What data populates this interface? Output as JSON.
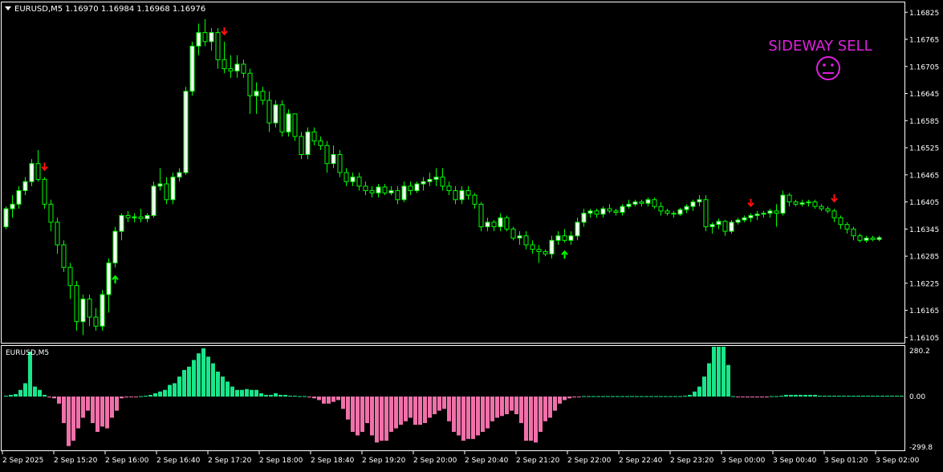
{
  "header": {
    "symbol_line": "EURUSD,M5  1.16970 1.16984 1.16968 1.16976",
    "dropdown_icon": "triangle-down-icon"
  },
  "signal": {
    "text": "SIDEWAY SELL",
    "icon": "neutral-face-icon",
    "color": "#e020e0"
  },
  "colors": {
    "background": "#000000",
    "frame": "#ffffff",
    "bull_body": "#ffffff",
    "bear_body": "#000000",
    "wick": "#00ff00",
    "sell_arrow": "#ff1010",
    "buy_arrow": "#00ff00",
    "histogram_positive": "#19e68a",
    "histogram_negative": "#f071aa",
    "zero_line": "#19e68a"
  },
  "indicator": {
    "label": "EURUSD,M5",
    "axis_labels": [
      "280.2",
      "0.00",
      "-299.8"
    ]
  },
  "chart_data": {
    "type": "candlestick",
    "title": "EURUSD,M5",
    "price_axis": {
      "ticks": [
        "1.16825",
        "1.16765",
        "1.16705",
        "1.16645",
        "1.16585",
        "1.16525",
        "1.16465",
        "1.16405",
        "1.16345",
        "1.16285",
        "1.16225",
        "1.16165",
        "1.16105"
      ],
      "ylim": [
        1.16095,
        1.16845
      ]
    },
    "time_axis": {
      "ticks": [
        "2 Sep 2025",
        "2 Sep 15:20",
        "2 Sep 16:00",
        "2 Sep 16:40",
        "2 Sep 17:20",
        "2 Sep 18:00",
        "2 Sep 18:40",
        "2 Sep 19:20",
        "2 Sep 20:00",
        "2 Sep 20:40",
        "2 Sep 21:20",
        "2 Sep 22:00",
        "2 Sep 22:40",
        "2 Sep 23:20",
        "3 Sep 00:00",
        "3 Sep 00:40",
        "3 Sep 01:20",
        "3 Sep 02:00"
      ],
      "bars_between_ticks": 8
    },
    "candles": [
      [
        1.1635,
        1.16395,
        1.16345,
        1.1639
      ],
      [
        1.1639,
        1.1642,
        1.1637,
        1.164
      ],
      [
        1.164,
        1.1644,
        1.1639,
        1.1643
      ],
      [
        1.1643,
        1.1646,
        1.1642,
        1.1645
      ],
      [
        1.1645,
        1.165,
        1.1644,
        1.1649
      ],
      [
        1.1649,
        1.1652,
        1.1645,
        1.16455
      ],
      [
        1.16455,
        1.1646,
        1.1639,
        1.164
      ],
      [
        1.164,
        1.1641,
        1.1634,
        1.1636
      ],
      [
        1.1636,
        1.1637,
        1.1629,
        1.1631
      ],
      [
        1.1631,
        1.1632,
        1.1625,
        1.1626
      ],
      [
        1.1626,
        1.1627,
        1.1619,
        1.1622
      ],
      [
        1.1622,
        1.1623,
        1.1612,
        1.1614
      ],
      [
        1.1614,
        1.162,
        1.1611,
        1.1619
      ],
      [
        1.1619,
        1.162,
        1.1613,
        1.1615
      ],
      [
        1.1615,
        1.1617,
        1.1612,
        1.1613
      ],
      [
        1.1613,
        1.1621,
        1.1612,
        1.162
      ],
      [
        1.162,
        1.1628,
        1.1616,
        1.1627
      ],
      [
        1.1627,
        1.1635,
        1.1626,
        1.1634
      ],
      [
        1.1634,
        1.1638,
        1.1632,
        1.16375
      ],
      [
        1.16375,
        1.16385,
        1.1636,
        1.1637
      ],
      [
        1.1637,
        1.1638,
        1.1636,
        1.16372
      ],
      [
        1.16372,
        1.1639,
        1.1636,
        1.16368
      ],
      [
        1.16368,
        1.1638,
        1.1636,
        1.16375
      ],
      [
        1.16375,
        1.1645,
        1.1637,
        1.1644
      ],
      [
        1.1644,
        1.1648,
        1.1643,
        1.16445
      ],
      [
        1.16445,
        1.1646,
        1.164,
        1.1641
      ],
      [
        1.1641,
        1.1647,
        1.164,
        1.1646
      ],
      [
        1.1646,
        1.1648,
        1.1645,
        1.1647
      ],
      [
        1.1647,
        1.1666,
        1.16465,
        1.1665
      ],
      [
        1.1665,
        1.1676,
        1.1664,
        1.1675
      ],
      [
        1.1675,
        1.168,
        1.1673,
        1.1678
      ],
      [
        1.1678,
        1.1681,
        1.1675,
        1.1676
      ],
      [
        1.1676,
        1.1679,
        1.1674,
        1.1678
      ],
      [
        1.1678,
        1.1679,
        1.167,
        1.1672
      ],
      [
        1.1672,
        1.1676,
        1.1669,
        1.167
      ],
      [
        1.167,
        1.1673,
        1.1668,
        1.16695
      ],
      [
        1.16695,
        1.1673,
        1.1668,
        1.1671
      ],
      [
        1.1671,
        1.1672,
        1.1668,
        1.1669
      ],
      [
        1.1669,
        1.167,
        1.166,
        1.1664
      ],
      [
        1.1664,
        1.1667,
        1.166,
        1.1665
      ],
      [
        1.1665,
        1.1666,
        1.1662,
        1.1663
      ],
      [
        1.1663,
        1.1665,
        1.1656,
        1.1658
      ],
      [
        1.1658,
        1.1663,
        1.1657,
        1.1662
      ],
      [
        1.1662,
        1.1663,
        1.1655,
        1.1656
      ],
      [
        1.1656,
        1.1661,
        1.1655,
        1.166
      ],
      [
        1.166,
        1.166,
        1.1654,
        1.1655
      ],
      [
        1.1655,
        1.1656,
        1.165,
        1.1651
      ],
      [
        1.1651,
        1.1657,
        1.165,
        1.1656
      ],
      [
        1.1656,
        1.1657,
        1.1653,
        1.1654
      ],
      [
        1.1654,
        1.1655,
        1.1652,
        1.1653
      ],
      [
        1.1653,
        1.1654,
        1.1647,
        1.1649
      ],
      [
        1.1649,
        1.1653,
        1.1648,
        1.1651
      ],
      [
        1.1651,
        1.1652,
        1.1646,
        1.1647
      ],
      [
        1.1647,
        1.1648,
        1.1644,
        1.1645
      ],
      [
        1.1645,
        1.1647,
        1.1644,
        1.1646
      ],
      [
        1.1646,
        1.1647,
        1.1643,
        1.1644
      ],
      [
        1.1644,
        1.1645,
        1.1642,
        1.1643
      ],
      [
        1.1643,
        1.1644,
        1.16415,
        1.16425
      ],
      [
        1.16425,
        1.16445,
        1.16415,
        1.16438
      ],
      [
        1.16438,
        1.16445,
        1.1642,
        1.16425
      ],
      [
        1.16425,
        1.1644,
        1.1642,
        1.1643
      ],
      [
        1.1643,
        1.1644,
        1.164,
        1.1641
      ],
      [
        1.1641,
        1.1645,
        1.16405,
        1.1644
      ],
      [
        1.1644,
        1.1645,
        1.1642,
        1.1643
      ],
      [
        1.1643,
        1.1645,
        1.16425,
        1.16445
      ],
      [
        1.16445,
        1.1646,
        1.1643,
        1.1645
      ],
      [
        1.1645,
        1.1647,
        1.1644,
        1.16455
      ],
      [
        1.16455,
        1.1648,
        1.1644,
        1.1646
      ],
      [
        1.1646,
        1.1648,
        1.1643,
        1.1644
      ],
      [
        1.1644,
        1.1645,
        1.1642,
        1.1643
      ],
      [
        1.1643,
        1.1644,
        1.164,
        1.1641
      ],
      [
        1.1641,
        1.1644,
        1.164,
        1.1643
      ],
      [
        1.1643,
        1.1644,
        1.1641,
        1.1642
      ],
      [
        1.1642,
        1.16425,
        1.1639,
        1.164
      ],
      [
        1.164,
        1.16405,
        1.1634,
        1.1635
      ],
      [
        1.1635,
        1.1637,
        1.1634,
        1.1636
      ],
      [
        1.1636,
        1.16365,
        1.1634,
        1.1635
      ],
      [
        1.1635,
        1.1638,
        1.1634,
        1.1637
      ],
      [
        1.1637,
        1.16375,
        1.1634,
        1.16345
      ],
      [
        1.16345,
        1.1635,
        1.1632,
        1.16325
      ],
      [
        1.16325,
        1.1634,
        1.1631,
        1.1633
      ],
      [
        1.1633,
        1.1634,
        1.163,
        1.1631
      ],
      [
        1.1631,
        1.1632,
        1.1629,
        1.163
      ],
      [
        1.163,
        1.1631,
        1.1627,
        1.16295
      ],
      [
        1.16295,
        1.163,
        1.16285,
        1.1629
      ],
      [
        1.1629,
        1.1633,
        1.1628,
        1.1632
      ],
      [
        1.1632,
        1.1634,
        1.1631,
        1.1633
      ],
      [
        1.1633,
        1.16345,
        1.16315,
        1.1632
      ],
      [
        1.1632,
        1.1634,
        1.1631,
        1.1633
      ],
      [
        1.1633,
        1.1637,
        1.1632,
        1.1636
      ],
      [
        1.1636,
        1.1639,
        1.1635,
        1.1638
      ],
      [
        1.1638,
        1.1639,
        1.1637,
        1.16385
      ],
      [
        1.16385,
        1.1639,
        1.1637,
        1.16378
      ],
      [
        1.16378,
        1.16395,
        1.1637,
        1.1639
      ],
      [
        1.1639,
        1.164,
        1.1638,
        1.16385
      ],
      [
        1.16385,
        1.1639,
        1.16375,
        1.16382
      ],
      [
        1.16382,
        1.164,
        1.16375,
        1.16395
      ],
      [
        1.16395,
        1.1641,
        1.1639,
        1.164
      ],
      [
        1.164,
        1.1641,
        1.16395,
        1.16405
      ],
      [
        1.16405,
        1.1641,
        1.16395,
        1.16402
      ],
      [
        1.16402,
        1.16415,
        1.16395,
        1.1641
      ],
      [
        1.1641,
        1.16415,
        1.1639,
        1.16395
      ],
      [
        1.16395,
        1.16405,
        1.16375,
        1.16385
      ],
      [
        1.16385,
        1.1639,
        1.16375,
        1.1638
      ],
      [
        1.1638,
        1.16385,
        1.1637,
        1.16378
      ],
      [
        1.16378,
        1.16392,
        1.16374,
        1.16388
      ],
      [
        1.16388,
        1.164,
        1.1638,
        1.16395
      ],
      [
        1.16395,
        1.1641,
        1.16385,
        1.16405
      ],
      [
        1.16405,
        1.1642,
        1.16395,
        1.1641
      ],
      [
        1.1641,
        1.1642,
        1.1634,
        1.1635
      ],
      [
        1.1635,
        1.1636,
        1.16335,
        1.16355
      ],
      [
        1.16355,
        1.16368,
        1.16345,
        1.16362
      ],
      [
        1.16362,
        1.16365,
        1.1633,
        1.1634
      ],
      [
        1.1634,
        1.16365,
        1.16335,
        1.1636
      ],
      [
        1.1636,
        1.1637,
        1.16355,
        1.16365
      ],
      [
        1.16365,
        1.16375,
        1.1636,
        1.1637
      ],
      [
        1.1637,
        1.1638,
        1.1636,
        1.16375
      ],
      [
        1.16375,
        1.16385,
        1.16365,
        1.16378
      ],
      [
        1.16378,
        1.16385,
        1.1637,
        1.1638
      ],
      [
        1.1638,
        1.1639,
        1.1637,
        1.16385
      ],
      [
        1.16385,
        1.164,
        1.1635,
        1.1638
      ],
      [
        1.1638,
        1.1643,
        1.16375,
        1.1642
      ],
      [
        1.1642,
        1.16425,
        1.16395,
        1.16405
      ],
      [
        1.16405,
        1.1641,
        1.16395,
        1.164
      ],
      [
        1.164,
        1.1641,
        1.16395,
        1.16403
      ],
      [
        1.16403,
        1.1641,
        1.16395,
        1.16405
      ],
      [
        1.16405,
        1.1641,
        1.1639,
        1.16395
      ],
      [
        1.16395,
        1.164,
        1.16385,
        1.1639
      ],
      [
        1.1639,
        1.16395,
        1.1638,
        1.16385
      ],
      [
        1.16385,
        1.1639,
        1.1636,
        1.1637
      ],
      [
        1.1637,
        1.16375,
        1.16345,
        1.16355
      ],
      [
        1.16355,
        1.1636,
        1.16335,
        1.16345
      ],
      [
        1.16345,
        1.1635,
        1.1632,
        1.1633
      ],
      [
        1.1633,
        1.16335,
        1.16315,
        1.1632
      ],
      [
        1.1632,
        1.1633,
        1.16315,
        1.16325
      ],
      [
        1.16325,
        1.1633,
        1.16318,
        1.16322
      ],
      [
        1.16322,
        1.1633,
        1.16318,
        1.16326
      ]
    ],
    "sell_arrow_bars": [
      6,
      34,
      116,
      129
    ],
    "buy_arrow_bars": [
      17,
      87
    ],
    "histogram": {
      "ylim": [
        -299.8,
        280.2
      ],
      "values": [
        5,
        10,
        15,
        40,
        80,
        270,
        60,
        40,
        10,
        -5,
        -10,
        -40,
        -150,
        -280,
        -250,
        -180,
        -120,
        -80,
        -150,
        -200,
        -170,
        -180,
        -120,
        -80,
        -10,
        -5,
        -3,
        -3,
        0,
        5,
        10,
        20,
        30,
        40,
        70,
        80,
        120,
        160,
        180,
        220,
        260,
        290,
        240,
        200,
        150,
        120,
        90,
        60,
        40,
        40,
        45,
        40,
        40,
        20,
        10,
        10,
        20,
        10,
        10,
        5,
        5,
        0,
        0,
        -5,
        -10,
        -20,
        -40,
        -40,
        -30,
        -20,
        -70,
        -130,
        -200,
        -220,
        -200,
        -150,
        -220,
        -260,
        -250,
        -250,
        -200,
        -180,
        -160,
        -140,
        -120,
        -160,
        -160,
        -150,
        -120,
        -100,
        -80,
        -70,
        -140,
        -200,
        -220,
        -250,
        -240,
        -240,
        -220,
        -200,
        -180,
        -140,
        -120,
        -110,
        -100,
        -80,
        -100,
        -150,
        -250,
        -250,
        -260,
        -200,
        -140,
        -120,
        -80,
        -40,
        -20,
        -10,
        -5,
        -3,
        0,
        0,
        0,
        0,
        0,
        0,
        0,
        0,
        0,
        0,
        0,
        0,
        0,
        0,
        0,
        0,
        0,
        0,
        0,
        0,
        0,
        5,
        10,
        30,
        60,
        120,
        200,
        330,
        420,
        420,
        190,
        0,
        -3,
        -3,
        -5,
        -5,
        -5,
        -5,
        -5,
        0,
        0,
        5,
        10,
        10,
        10,
        10,
        10,
        10,
        10,
        5,
        5,
        5,
        5,
        5,
        5,
        5,
        5,
        5,
        5,
        5,
        5,
        5,
        5,
        5,
        5,
        5,
        5,
        5,
        5,
        5,
        5,
        5,
        5,
        5,
        5,
        5,
        5,
        5,
        5,
        5,
        5,
        5,
        5,
        5,
        5,
        5,
        5,
        5,
        5
      ]
    }
  }
}
